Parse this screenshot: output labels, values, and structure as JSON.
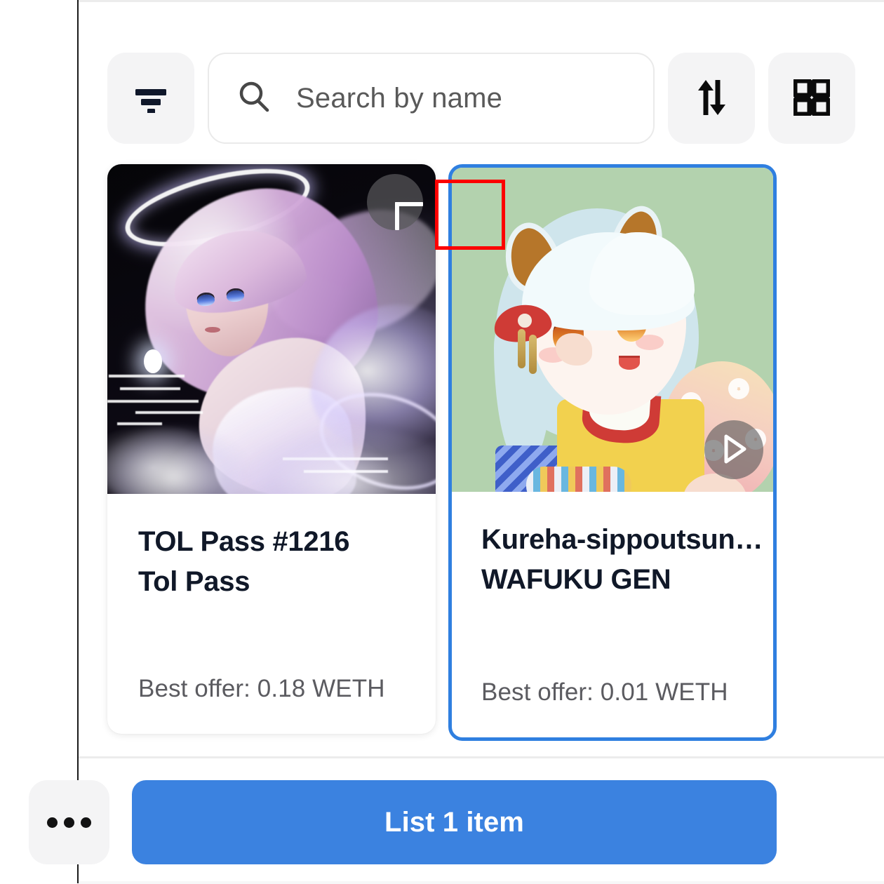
{
  "toolbar": {
    "filter_icon": "filter-icon",
    "search": {
      "icon": "search-icon",
      "placeholder": "Search by name",
      "value": ""
    },
    "sort_icon": "sort-arrows-icon",
    "grid_icon": "grid-view-icon"
  },
  "cards": [
    {
      "selected": false,
      "title": "TOL Pass #1216",
      "collection": "Tol Pass",
      "offer": "Best offer: 0.18 WETH",
      "overlay_action": "add-icon",
      "media_type": "image"
    },
    {
      "selected": true,
      "title": "Kureha-sippoutsun…",
      "collection": "WAFUKU GEN",
      "offer": "Best offer: 0.01 WETH",
      "overlay_action": "play-icon",
      "media_type": "video"
    }
  ],
  "annotation": {
    "target": "add-to-list-button",
    "color": "#fc0000"
  },
  "footer": {
    "more_label": "more-options",
    "primary_label": "List 1 item"
  },
  "colors": {
    "accent": "#3b82e0",
    "selected_border": "#2f7fe0",
    "chip_bg": "#f4f4f5",
    "text_primary": "#101828",
    "text_muted": "#5b5b60",
    "annotation": "#fc0000",
    "chibi_bg": "#b3d2ae"
  }
}
